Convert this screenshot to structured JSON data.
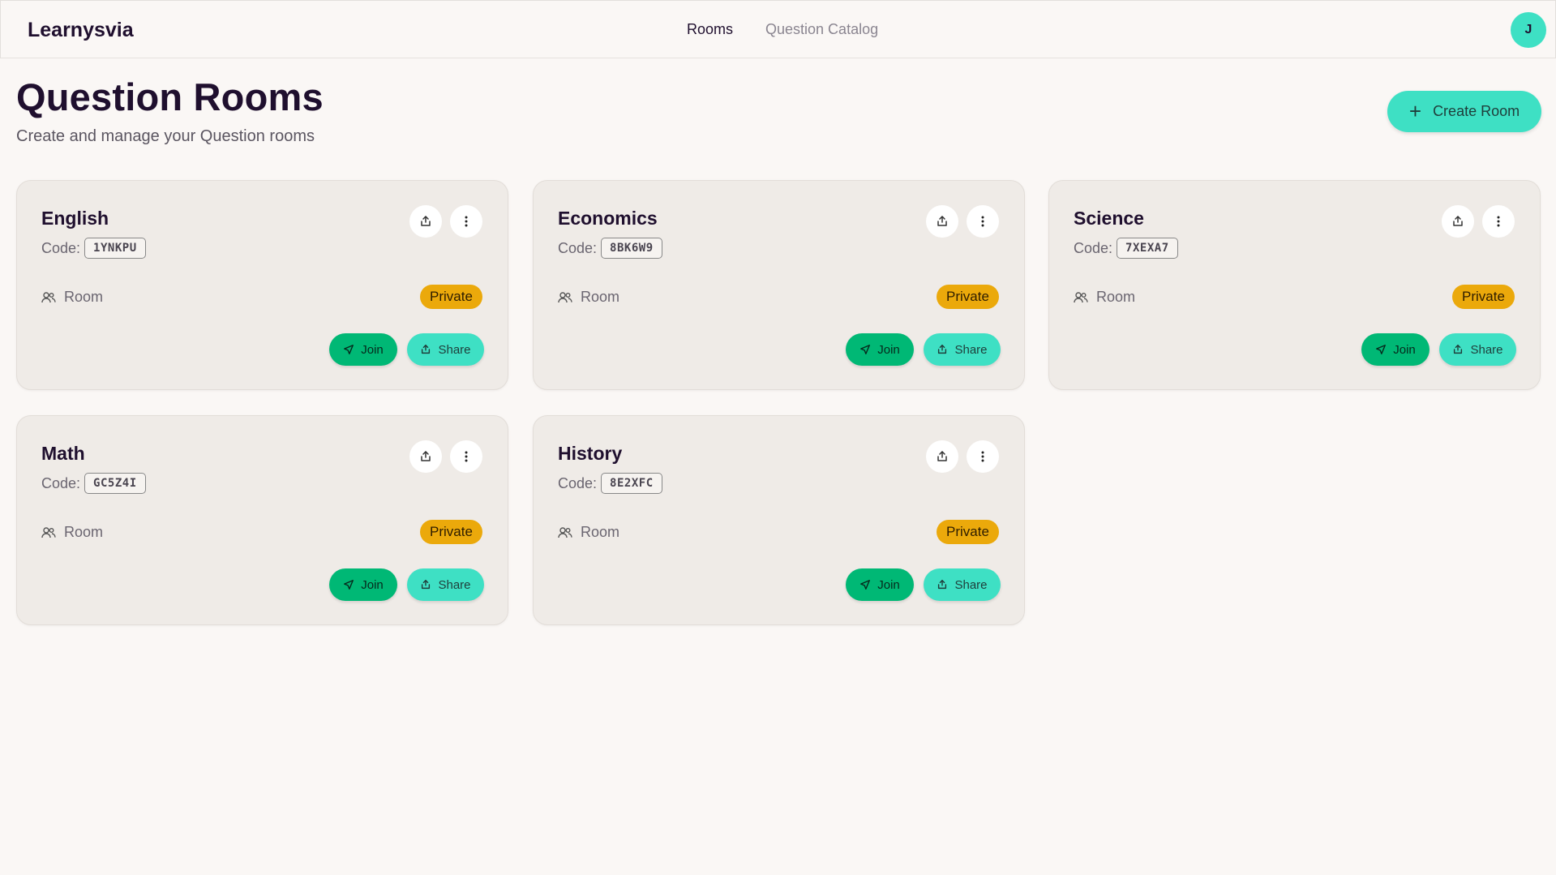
{
  "app": {
    "brand": "Learnysvia",
    "avatar_initial": "J"
  },
  "nav": {
    "items": [
      {
        "label": "Rooms",
        "active": true
      },
      {
        "label": "Question Catalog",
        "active": false
      }
    ]
  },
  "header": {
    "title": "Question Rooms",
    "subtitle": "Create and manage your Question rooms",
    "create_label": "Create Room"
  },
  "card_labels": {
    "code_prefix": "Code:",
    "room_label": "Room",
    "join_label": "Join",
    "share_label": "Share"
  },
  "rooms": [
    {
      "name": "English",
      "code": "1YNKPU",
      "visibility": "Private"
    },
    {
      "name": "Economics",
      "code": "8BK6W9",
      "visibility": "Private"
    },
    {
      "name": "Science",
      "code": "7XEXA7",
      "visibility": "Private"
    },
    {
      "name": "Math",
      "code": "GC5Z4I",
      "visibility": "Private"
    },
    {
      "name": "History",
      "code": "8E2XFC",
      "visibility": "Private"
    }
  ],
  "colors": {
    "accent": "#3ee0c4",
    "join": "#00b875",
    "private_badge": "#eba90b",
    "title": "#1f0f2e",
    "background": "#faf7f5"
  },
  "icons": {
    "card_share": "share-icon",
    "card_more": "more-vertical-icon",
    "room": "users-icon",
    "join": "send-icon",
    "share": "share-icon",
    "create": "plus-icon"
  }
}
